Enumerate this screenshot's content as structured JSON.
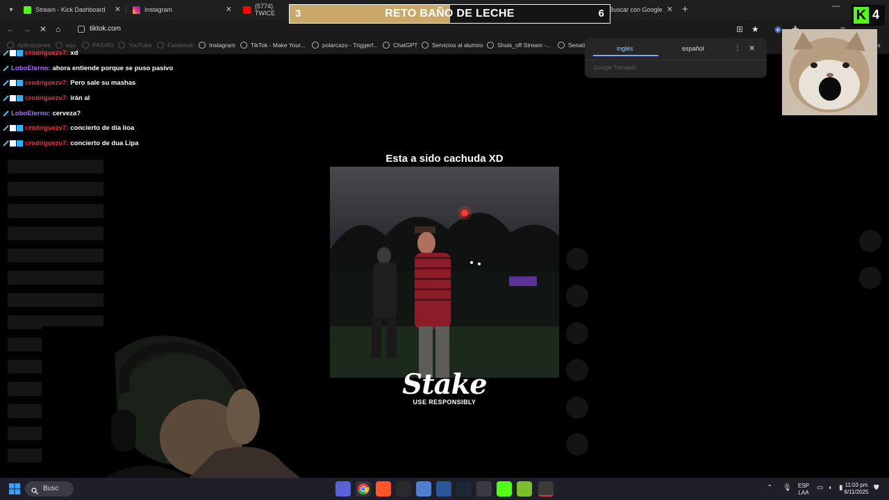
{
  "browser": {
    "tabs": [
      {
        "title": "Stream - Kick Dashboard",
        "favicon": "kick-favicon"
      },
      {
        "title": "Instagram",
        "favicon": "instagram-favicon"
      },
      {
        "title": "(5774) TWICE",
        "favicon": "youtube-favicon"
      },
      {
        "title": "masha - Buscar con Google",
        "favicon": "google-favicon"
      }
    ],
    "url": "tiktok.com",
    "bookmarks": [
      "Aplicaciones",
      "aqu",
      "PASVIO",
      "YouTube",
      "Facebook",
      "Instagram",
      "TikTok - Make Your...",
      "polarcazo - Triggerf...",
      "ChatGPT",
      "Servicios al alumno",
      "Shuls_off Stream -...",
      "Senati",
      "ppitos"
    ]
  },
  "overlay": {
    "left_count": "3",
    "title": "RETO BAÑO DE LECHE",
    "right_count": "6",
    "progress": 0.5,
    "accent_color": "#c9a86a"
  },
  "kick": {
    "count": "4",
    "brand_color": "#53fc18"
  },
  "translate": {
    "lang_from": "inglés",
    "lang_to": "español",
    "brand": "Google Translate"
  },
  "chat": {
    "messages": [
      {
        "user": "crodriguezv7:",
        "text": "xd",
        "color": "#e5343c"
      },
      {
        "user": "LoboEterno:",
        "text": "ahora entiende porque se puso pasivo",
        "color": "#a970ff"
      },
      {
        "user": "crodriguezv7:",
        "text": "Pero sale su mashas",
        "color": "#e5343c"
      },
      {
        "user": "crodriguezv7:",
        "text": "irán al",
        "color": "#e5343c"
      },
      {
        "user": "LoboEterno:",
        "text": "cerveza?",
        "color": "#a970ff"
      },
      {
        "user": "crodriguezv7:",
        "text": "concierto de dia lioa",
        "color": "#e5343c"
      },
      {
        "user": "crodriguezv7:",
        "text": "concierto de dua Lipa",
        "color": "#e5343c"
      }
    ]
  },
  "video": {
    "caption": "Esta a sido cachuda XD",
    "sponsor": "Stake",
    "sponsor_tag": "USE RESPONSIBLY"
  },
  "taskbar": {
    "search": "Busc",
    "lang": "ESP",
    "lang_sub": "LAA",
    "time": "11:03 pm",
    "date": "8/11/2025"
  }
}
